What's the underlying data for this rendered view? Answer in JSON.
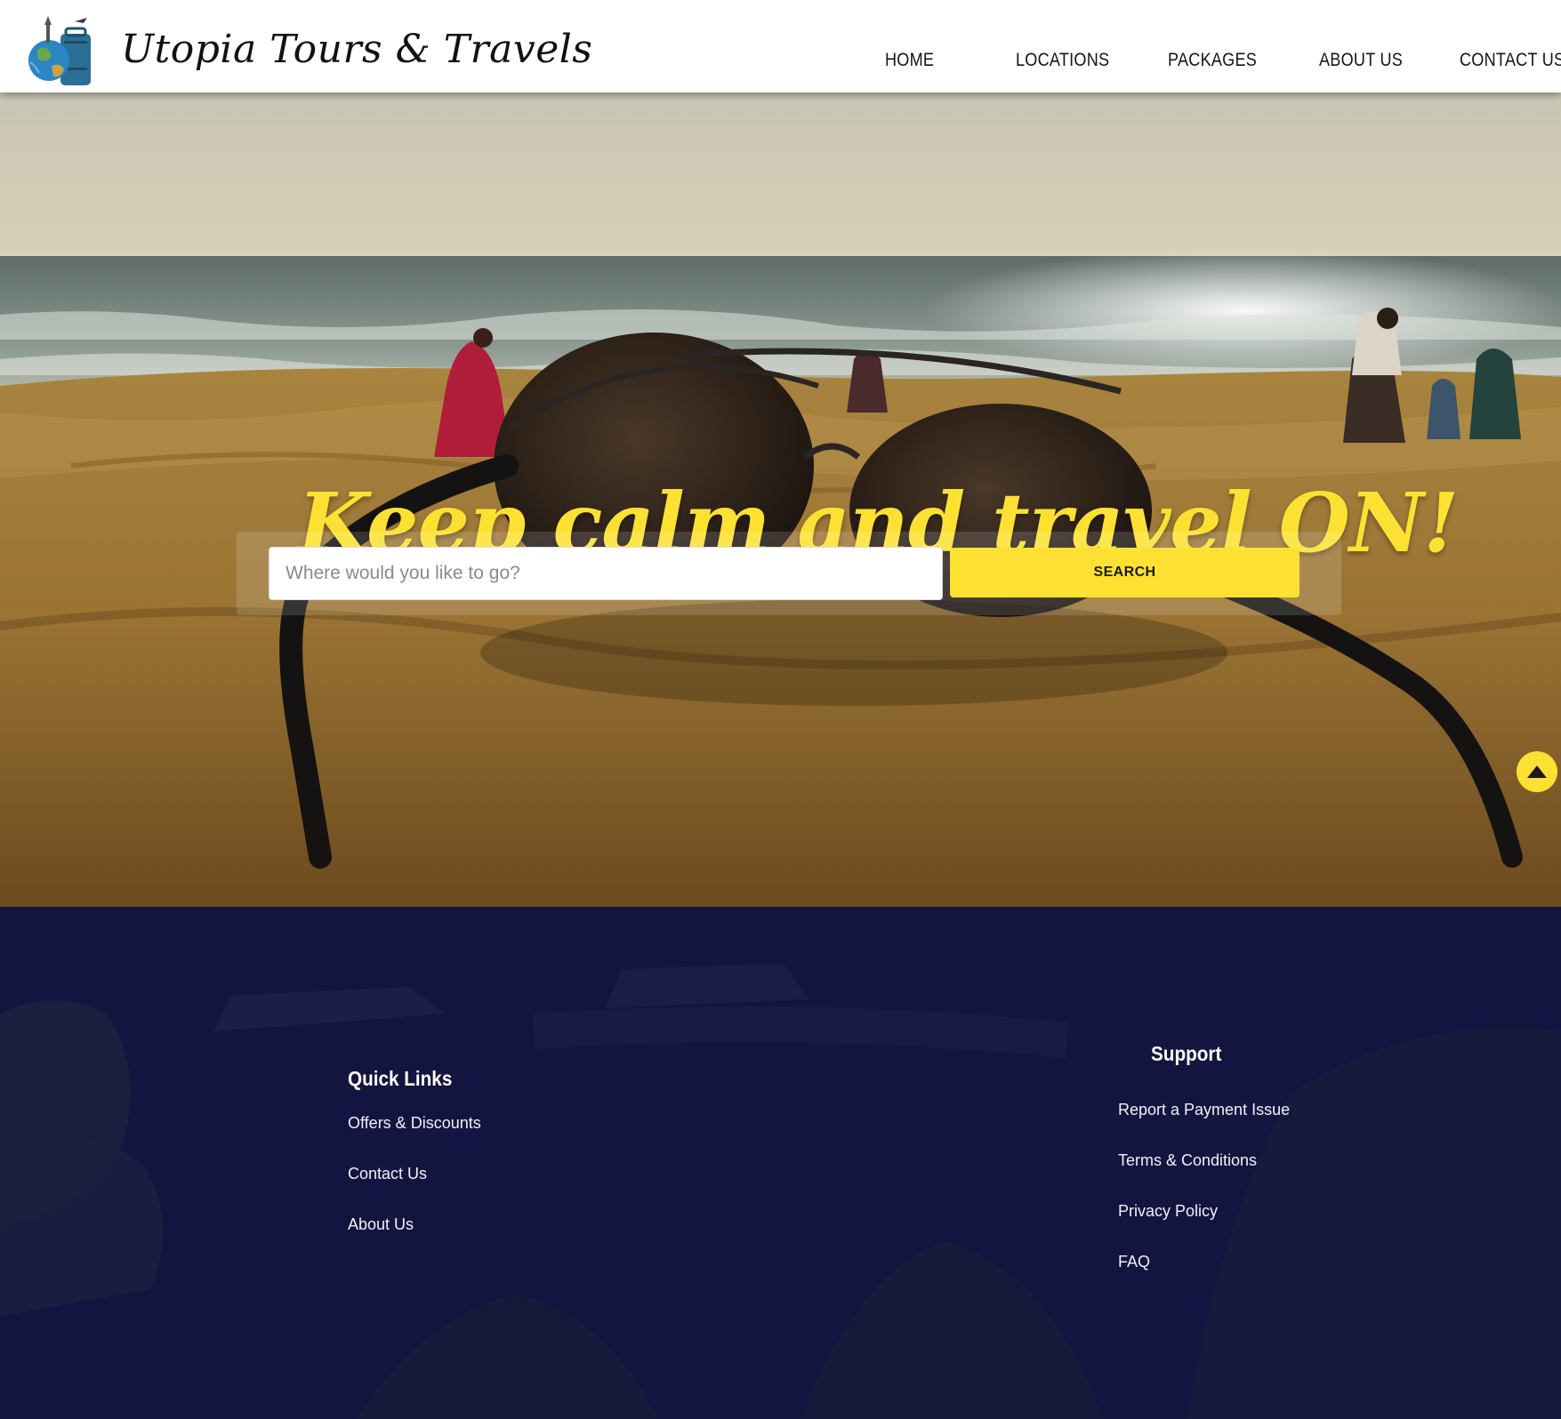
{
  "header": {
    "brand": "Utopia Tours & Travels",
    "logo_icon": "globe-luggage-icon",
    "nav": [
      {
        "label": "HOME"
      },
      {
        "label": "LOCATIONS"
      },
      {
        "label": "PACKAGES"
      },
      {
        "label": "ABOUT US"
      },
      {
        "label": "CONTACT US"
      }
    ]
  },
  "hero": {
    "tagline": "Keep calm and travel ON!",
    "search": {
      "placeholder": "Where would you like to go?",
      "value": "",
      "button_label": "SEARCH"
    },
    "scroll_top_icon": "arrow-up-icon"
  },
  "footer": {
    "quick_links": {
      "heading": "Quick Links",
      "links": [
        "Offers & Discounts",
        "Contact Us",
        "About Us"
      ]
    },
    "support": {
      "heading": "Support",
      "links": [
        "Report a Payment Issue",
        "Terms & Conditions",
        "Privacy Policy",
        "FAQ"
      ]
    }
  },
  "colors": {
    "accent_yellow": "#fde132",
    "footer_navy": "#141440",
    "header_bg": "#ffffff",
    "nav_text": "#151515"
  }
}
